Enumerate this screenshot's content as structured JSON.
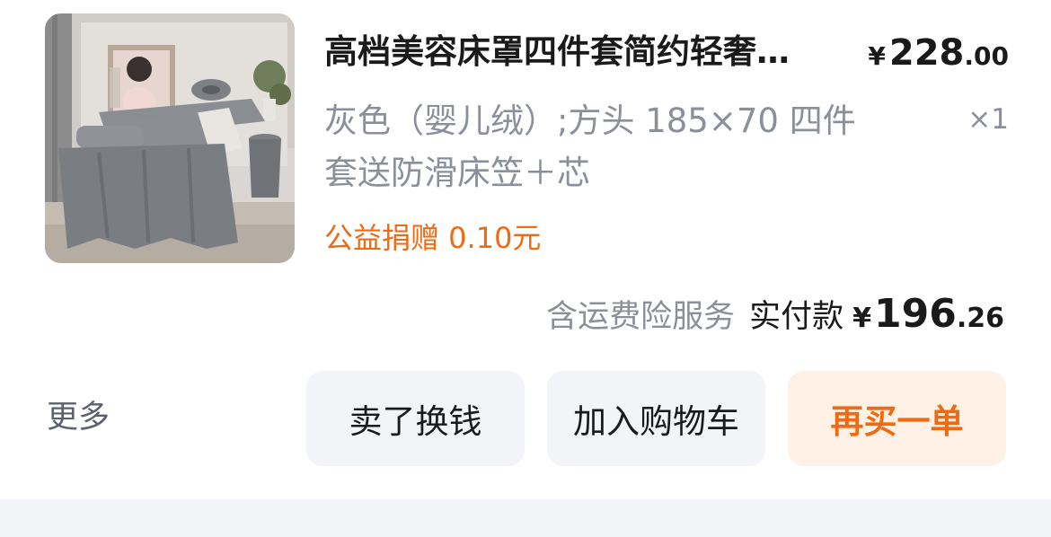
{
  "product": {
    "title": "高档美容床罩四件套简约轻奢…",
    "price_symbol": "¥",
    "price_int": "228",
    "price_dec": ".00",
    "spec": "灰色（婴儿绒）;方头 185×70 四件套送防滑床笠＋芯",
    "quantity": "×1",
    "donation": "公益捐赠 0.10元",
    "image_icon": "massage-bed-photo"
  },
  "summary": {
    "insurance": "含运费险服务",
    "paid_label": "实付款",
    "paid_symbol": "¥",
    "paid_int": "196",
    "paid_dec": ".26"
  },
  "actions": {
    "more_label": "更多",
    "sell_label": "卖了换钱",
    "cart_label": "加入购物车",
    "rebuy_label": "再买一单"
  },
  "colors": {
    "accent": "#ee6a13",
    "accent_bg": "#fff1e6",
    "button_bg": "#f3f4f7",
    "muted_text": "#8a8f99"
  }
}
